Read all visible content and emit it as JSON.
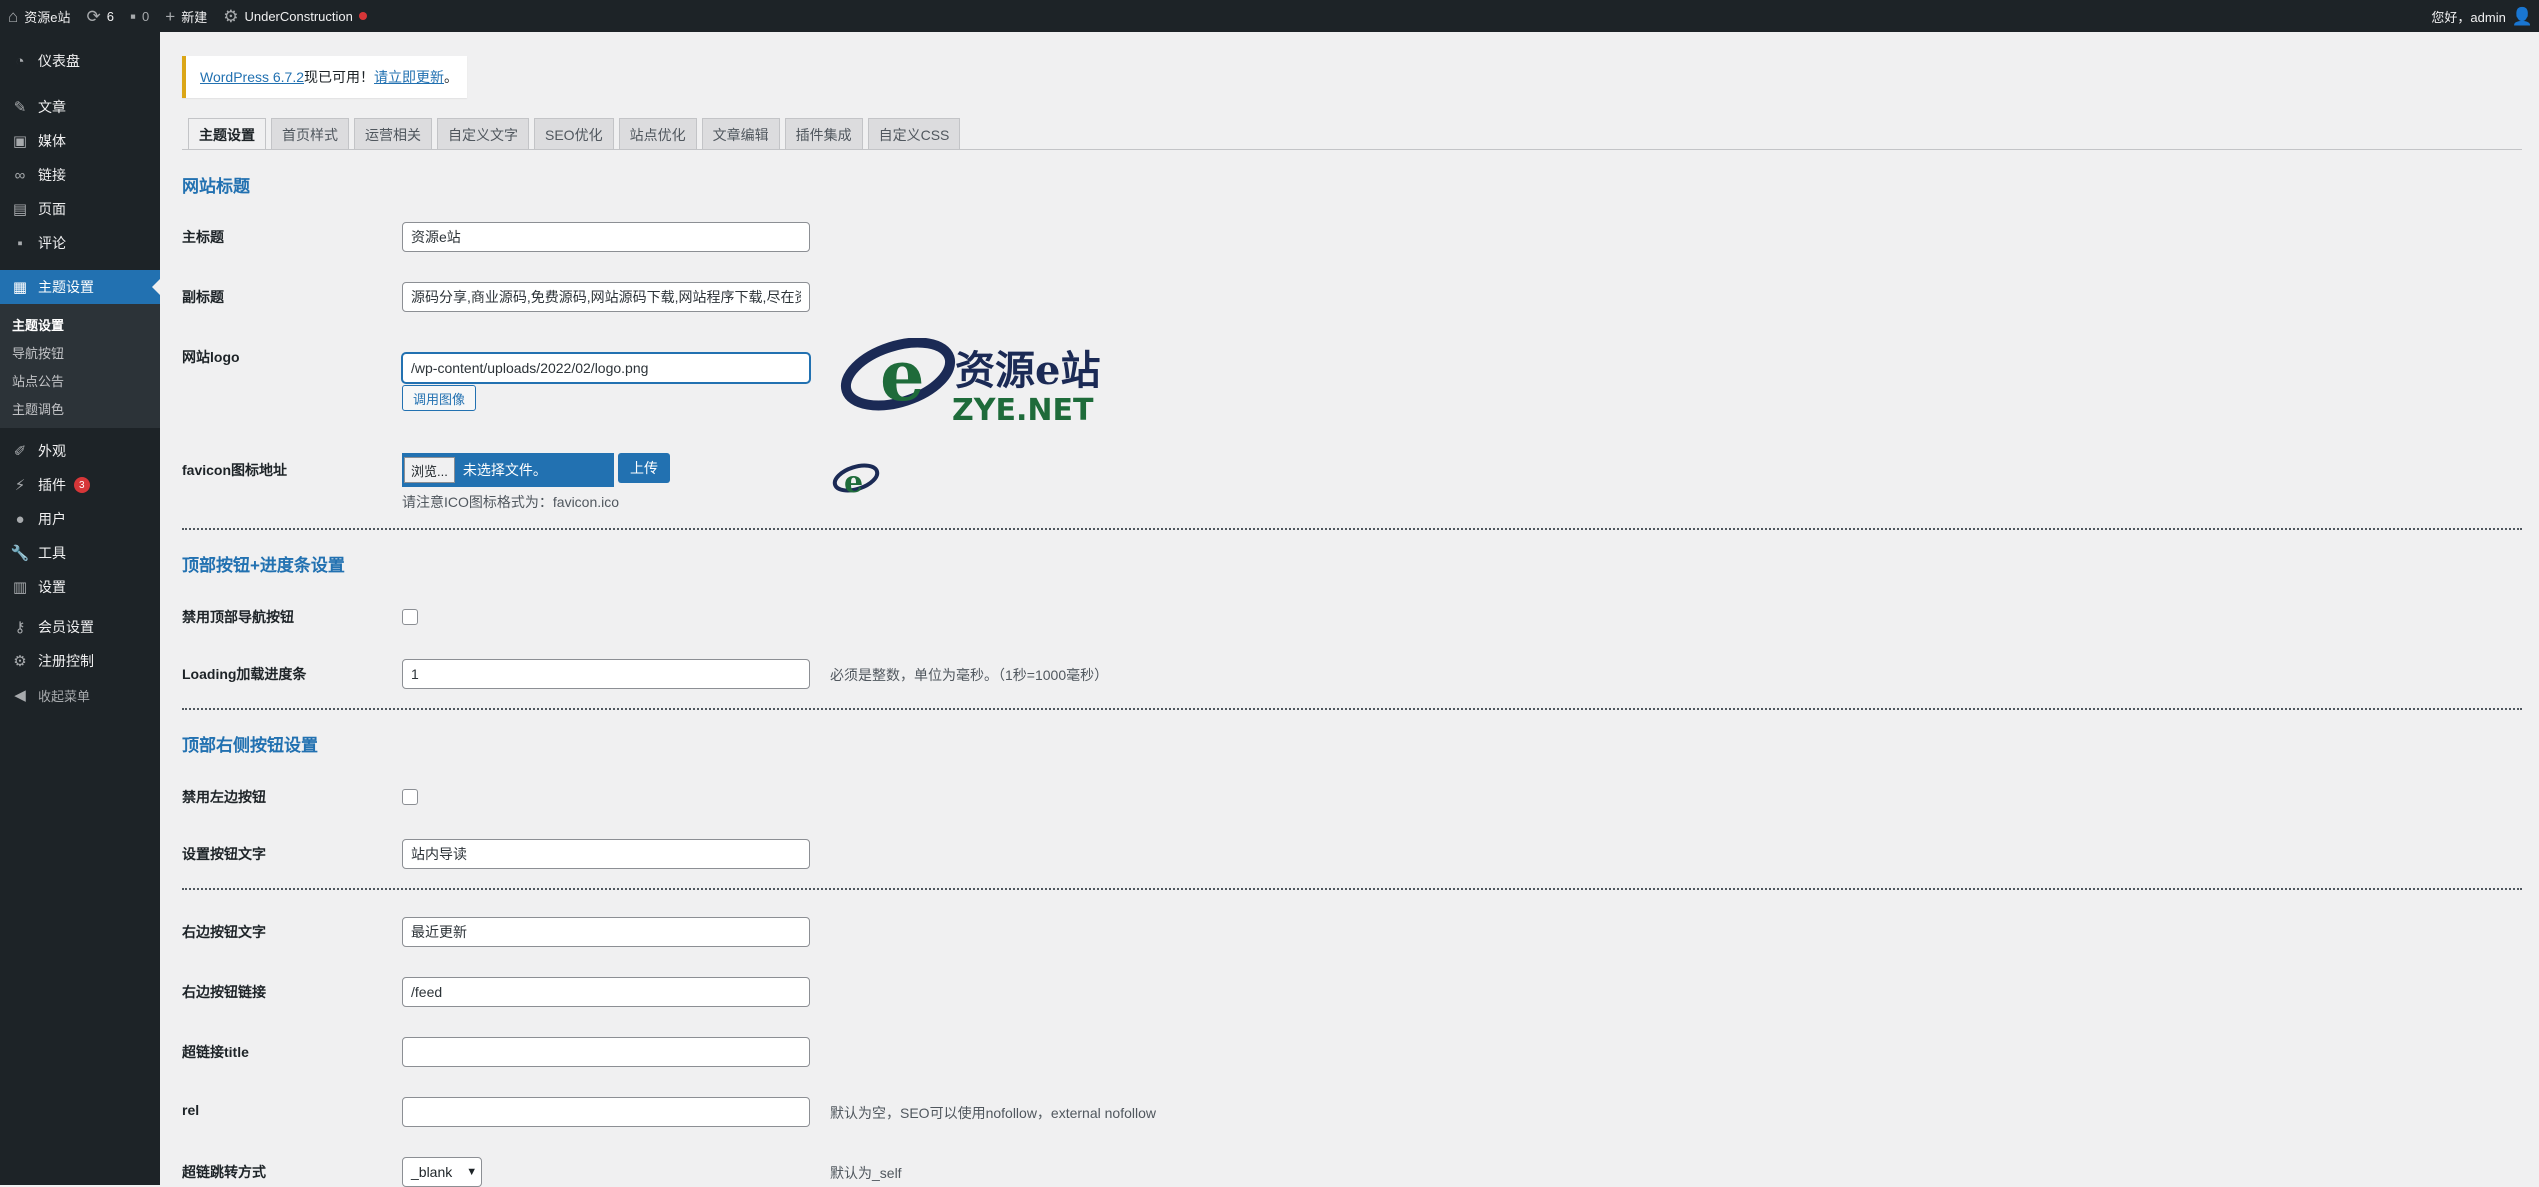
{
  "adminbar": {
    "site_name": "资源e站",
    "updates_count": "6",
    "comments_count": "0",
    "new_label": "新建",
    "theme_label": "UnderConstruction",
    "greeting": "您好，admin"
  },
  "sidebar": {
    "items": [
      {
        "label": "仪表盘",
        "icon": "dashboard-icon"
      },
      {
        "label": "文章",
        "icon": "pin-icon"
      },
      {
        "label": "媒体",
        "icon": "media-icon"
      },
      {
        "label": "链接",
        "icon": "link-icon"
      },
      {
        "label": "页面",
        "icon": "page-icon"
      },
      {
        "label": "评论",
        "icon": "comment-icon"
      },
      {
        "label": "主题设置",
        "icon": "theme-settings-icon"
      },
      {
        "label": "外观",
        "icon": "brush-icon"
      },
      {
        "label": "插件",
        "icon": "plugin-icon",
        "badge": "3"
      },
      {
        "label": "用户",
        "icon": "user-icon"
      },
      {
        "label": "工具",
        "icon": "wrench-icon"
      },
      {
        "label": "设置",
        "icon": "settings-icon"
      },
      {
        "label": "会员设置",
        "icon": "key-icon"
      },
      {
        "label": "注册控制",
        "icon": "gear-icon"
      },
      {
        "label": "收起菜单",
        "icon": "collapse-icon"
      }
    ],
    "submenu": [
      "主题设置",
      "导航按钮",
      "站点公告",
      "主题调色"
    ]
  },
  "notice": {
    "link1": "WordPress 6.7.2",
    "text": "现已可用！",
    "link2": "请立即更新",
    "end": "。"
  },
  "tabs": [
    "主题设置",
    "首页样式",
    "运营相关",
    "自定义文字",
    "SEO优化",
    "站点优化",
    "文章编辑",
    "插件集成",
    "自定义CSS"
  ],
  "sections": {
    "site_title": "网站标题",
    "top_buttons": "顶部按钮+进度条设置",
    "top_right": "顶部右侧按钮设置"
  },
  "fields": {
    "main_title_label": "主标题",
    "main_title_value": "资源e站",
    "subtitle_label": "副标题",
    "subtitle_value": "源码分享,商业源码,免费源码,网站源码下载,网站程序下载,尽在资源e站",
    "logo_label": "网站logo",
    "logo_value": "/wp-content/uploads/2022/02/logo.png",
    "logo_button": "调用图像",
    "logo_text_cn": "资源e站",
    "logo_text_en": "ZYE.NET",
    "favicon_label": "favicon图标地址",
    "browse_label": "浏览...",
    "no_file": "未选择文件。",
    "upload_label": "上传",
    "favicon_hint": "请注意ICO图标格式为：favicon.ico",
    "disable_top_nav_label": "禁用顶部导航按钮",
    "loading_label": "Loading加载进度条",
    "loading_value": "1",
    "loading_desc": "必须是整数，单位为毫秒。（1秒=1000毫秒）",
    "disable_left_label": "禁用左边按钮",
    "set_btn_text_label": "设置按钮文字",
    "set_btn_text_value": "站内导读",
    "right_btn_text_label": "右边按钮文字",
    "right_btn_text_value": "最近更新",
    "right_btn_link_label": "右边按钮链接",
    "right_btn_link_value": "/feed",
    "link_title_label": "超链接title",
    "link_title_value": "",
    "rel_label": "rel",
    "rel_value": "",
    "rel_desc": "默认为空，SEO可以使用nofollow，external nofollow",
    "target_label": "超链跳转方式",
    "target_value": "_blank",
    "target_desc": "默认为_self"
  },
  "colors": {
    "accent": "#2271b1",
    "adminbar": "#1d2327",
    "logo_green": "#1e6b3a",
    "logo_navy": "#1b2a55"
  }
}
